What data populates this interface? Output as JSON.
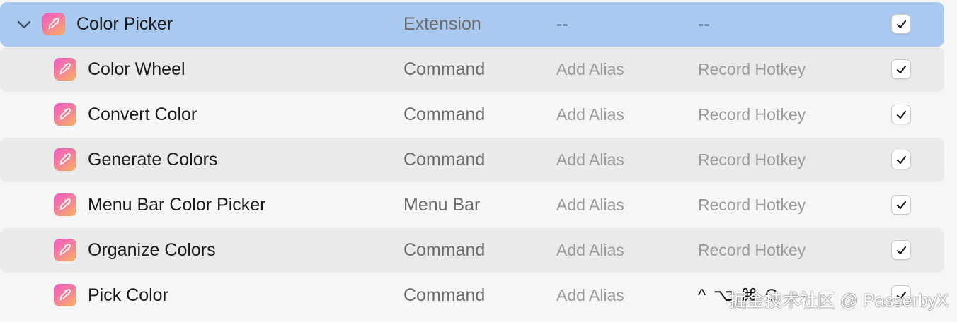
{
  "extension": {
    "name": "Color Picker",
    "type": "Extension",
    "alias": "--",
    "hotkey": "--",
    "enabled": true,
    "expanded": true,
    "icon": "eyedropper-icon"
  },
  "commands": [
    {
      "name": "Color Wheel",
      "type": "Command",
      "alias": "Add Alias",
      "hotkey": "Record Hotkey",
      "enabled": true
    },
    {
      "name": "Convert Color",
      "type": "Command",
      "alias": "Add Alias",
      "hotkey": "Record Hotkey",
      "enabled": true
    },
    {
      "name": "Generate Colors",
      "type": "Command",
      "alias": "Add Alias",
      "hotkey": "Record Hotkey",
      "enabled": true
    },
    {
      "name": "Menu Bar Color Picker",
      "type": "Menu Bar",
      "alias": "Add Alias",
      "hotkey": "Record Hotkey",
      "enabled": true
    },
    {
      "name": "Organize Colors",
      "type": "Command",
      "alias": "Add Alias",
      "hotkey": "Record Hotkey",
      "enabled": true
    },
    {
      "name": "Pick Color",
      "type": "Command",
      "alias": "Add Alias",
      "hotkey": "^ ⌥ ⌘ C",
      "enabled": true
    }
  ],
  "watermark": "掘金技术社区 @ PasserbyX",
  "colors": {
    "selected_row": "#a9c9f1",
    "alt_row": "#eaeaea",
    "background": "#f6f6f6",
    "icon_gradient": [
      "#f25ac7",
      "#f47ca0",
      "#f7b35a"
    ]
  }
}
